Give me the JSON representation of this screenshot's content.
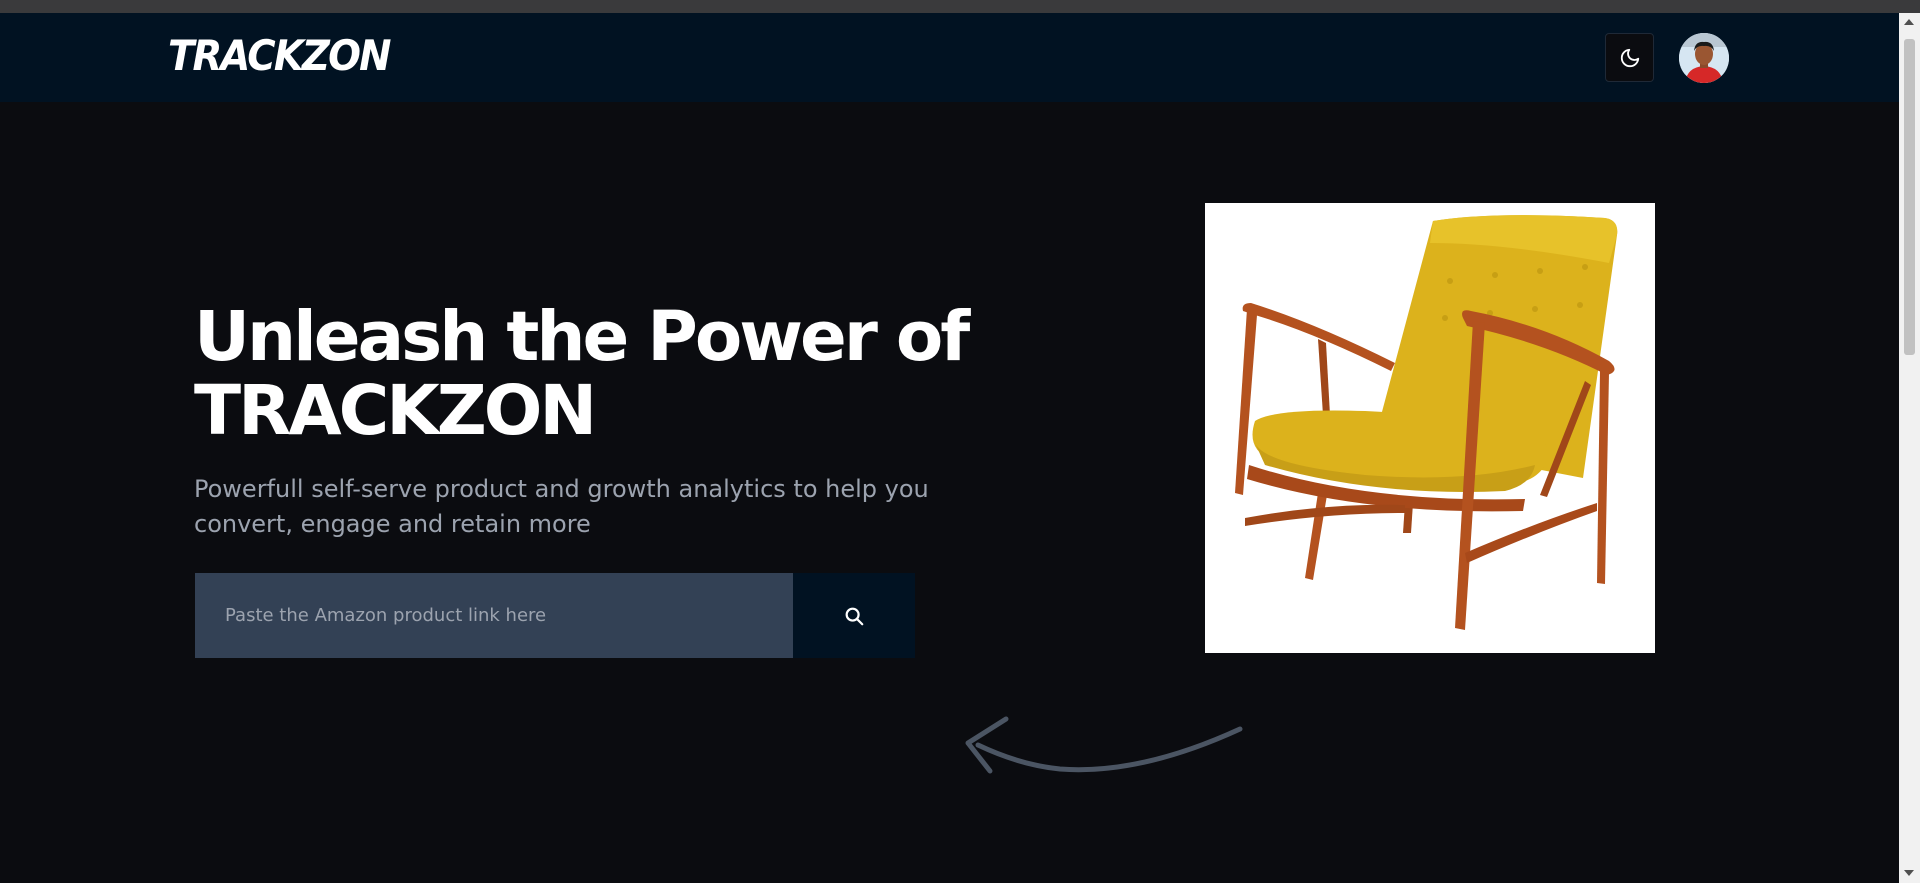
{
  "brand": {
    "logo_text": "TRACKZON"
  },
  "header": {
    "theme_toggle_icon": "moon-icon",
    "avatar_icon": "user-avatar"
  },
  "hero": {
    "title_line1": "Unleash the Power of",
    "title_line2": "TRACKZON",
    "subtitle_line1": "Powerfull self-serve product and growth analytics to help you",
    "subtitle_line2": "convert, engage and retain more"
  },
  "search": {
    "placeholder": "Paste the Amazon product link here",
    "value": "",
    "button_icon": "search-icon"
  },
  "colors": {
    "background": "#0b0c10",
    "navbar": "#011222",
    "input": "#334155",
    "subtitle": "#9ca3af",
    "chair": "#dcb21c",
    "wood": "#b4521f"
  }
}
